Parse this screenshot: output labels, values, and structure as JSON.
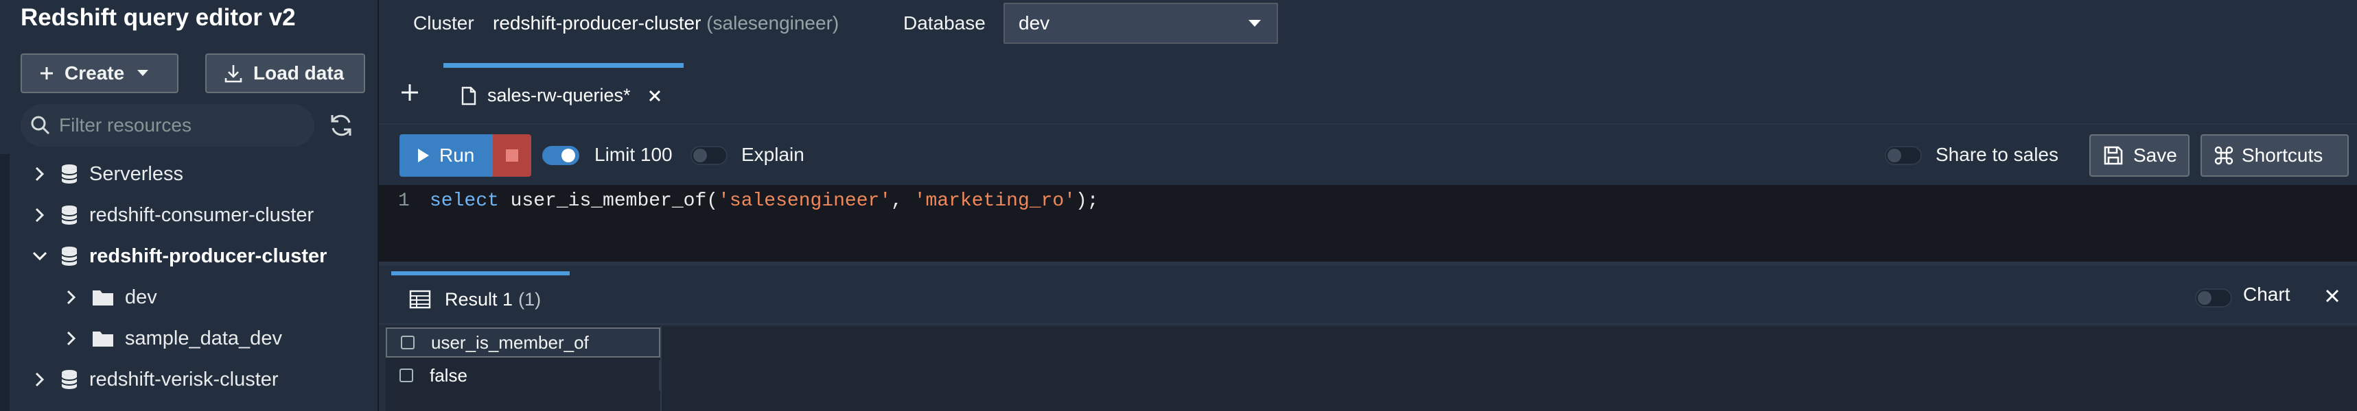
{
  "sidebar": {
    "app_title": "Redshift query editor v2",
    "create_label": "Create",
    "load_label": "Load data",
    "filter_placeholder": "Filter resources",
    "tree": [
      {
        "label": "Serverless",
        "expanded": false,
        "icon": "database-icon"
      },
      {
        "label": "redshift-consumer-cluster",
        "expanded": false,
        "icon": "database-icon"
      },
      {
        "label": "redshift-producer-cluster",
        "expanded": true,
        "icon": "database-icon"
      },
      {
        "label": "dev",
        "expanded": false,
        "icon": "folder-icon"
      },
      {
        "label": "sample_data_dev",
        "expanded": false,
        "icon": "folder-icon"
      },
      {
        "label": "redshift-verisk-cluster",
        "expanded": false,
        "icon": "database-icon"
      }
    ]
  },
  "connection": {
    "cluster_label": "Cluster",
    "cluster_value": "redshift-producer-cluster",
    "cluster_user": "(salesengineer)",
    "database_label": "Database",
    "database_value": "dev"
  },
  "tabs": [
    {
      "label": "sales-rw-queries*",
      "active": true
    }
  ],
  "toolbar": {
    "run_label": "Run",
    "limit_label": "Limit 100",
    "limit_enabled": true,
    "explain_label": "Explain",
    "explain_enabled": false,
    "share_label": "Share to sales",
    "share_enabled": false,
    "save_label": "Save",
    "shortcuts_label": "Shortcuts"
  },
  "editor": {
    "line_number": "1",
    "tokens": {
      "kw": "select",
      "fn_open": " user_is_member_of(",
      "arg1": "'salesengineer'",
      "sep": ", ",
      "arg2": "'marketing_ro'",
      "close": ");"
    }
  },
  "results": {
    "tab_label": "Result 1",
    "tab_count": "(1)",
    "chart_label": "Chart",
    "chart_enabled": false,
    "columns": [
      "user_is_member_of"
    ],
    "rows": [
      [
        "false"
      ]
    ]
  },
  "colors": {
    "background": "#232f3e",
    "editor_background": "#16191f",
    "accent": "#3a80c5",
    "tab_indicator": "#4c9bdc",
    "stop": "#b3433f",
    "keyword": "#6fb5f5",
    "string": "#f0885b"
  }
}
